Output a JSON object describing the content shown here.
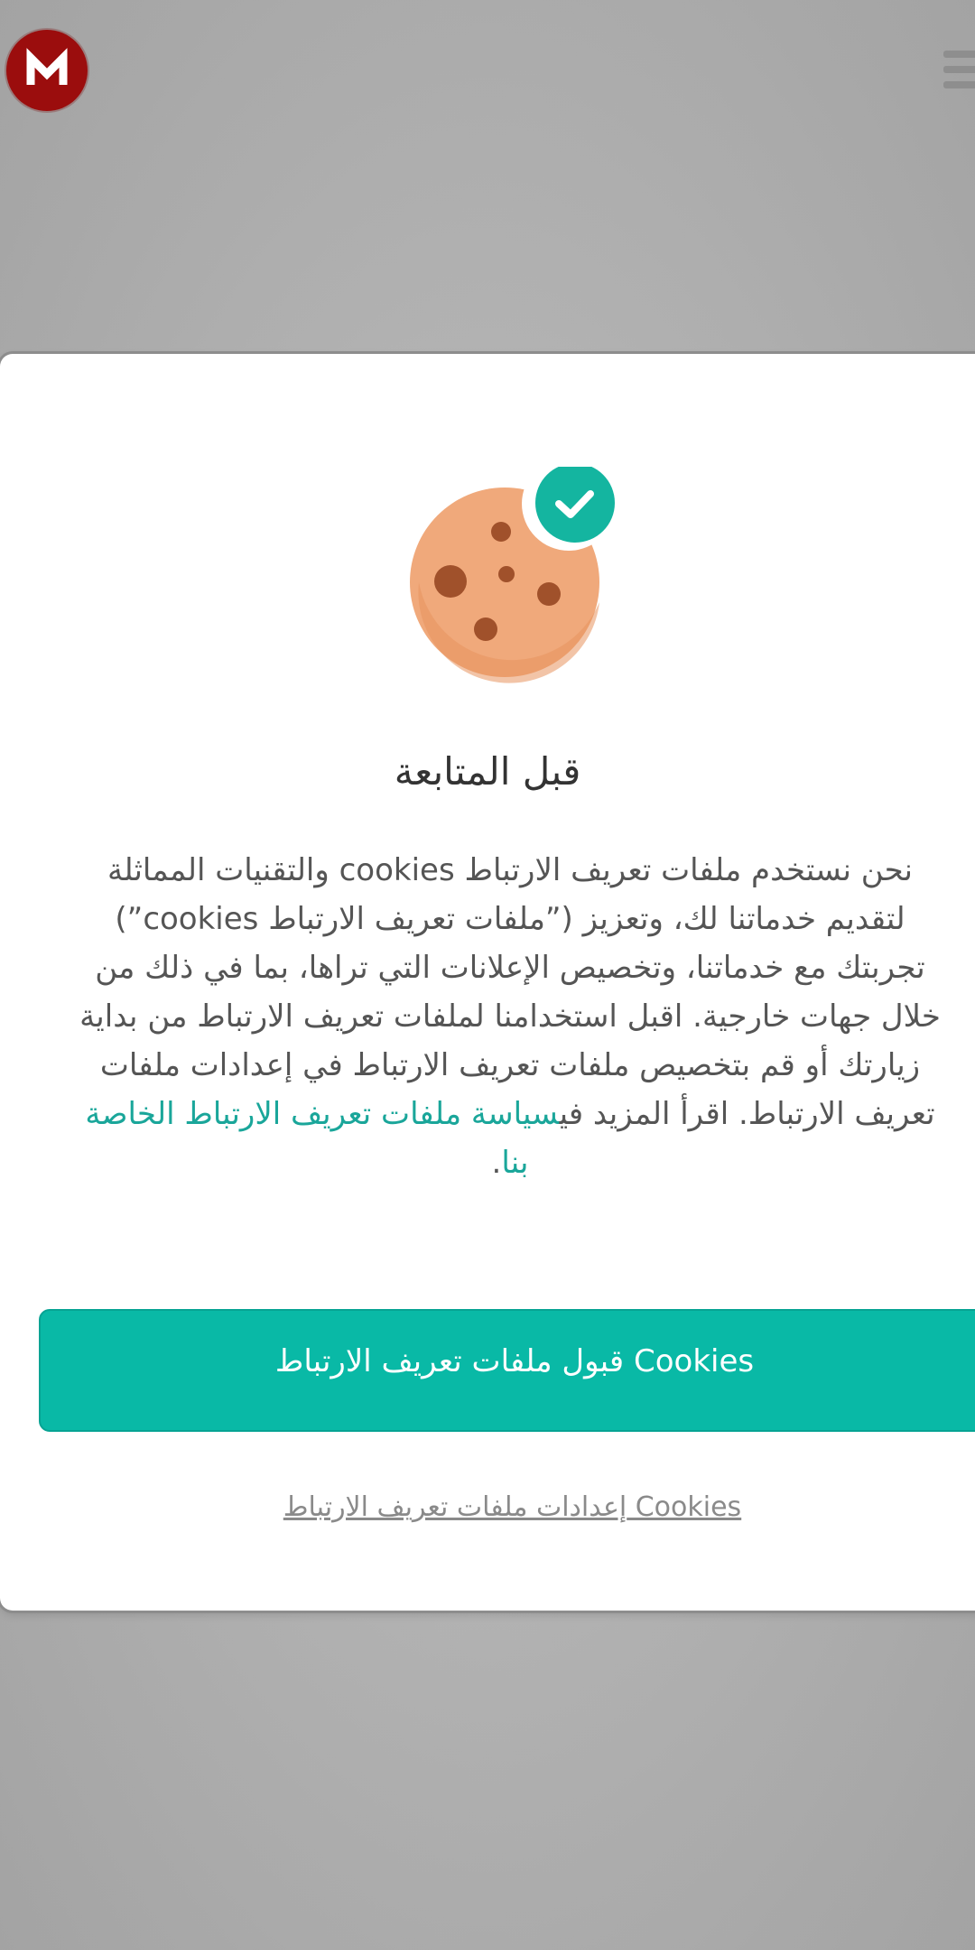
{
  "header": {
    "logo_letter": "M",
    "logo_color": "#9b0d0d",
    "menu_icon": "hamburger-menu-icon"
  },
  "dialog": {
    "illustration": "cookie-with-check-icon",
    "title": "قبل المتابعة",
    "body_text": "نحن نستخدم ملفات تعريف الارتباط cookies والتقنيات المماثلة لتقديم خدماتنا لك، وتعزيز (”ملفات تعريف الارتباط cookies”) تجربتك مع خدماتنا، وتخصيص الإعلانات التي تراها، بما في ذلك من خلال جهات خارجية. اقبل استخدامنا لملفات تعريف الارتباط من بداية زيارتك أو قم بتخصيص ملفات تعريف الارتباط في إعدادات ملفات تعريف الارتباط. اقرأ المزيد في",
    "policy_link": "سياسة ملفات تعريف الارتباط الخاصة بنا",
    "body_end": ".",
    "accept_button": "قبول ملفات تعريف الارتباط Cookies",
    "settings_link": "إعدادات ملفات تعريف الارتباط Cookies"
  },
  "colors": {
    "accent": "#09b9a6",
    "link": "#1aa69a",
    "cookie": "#f0a97b",
    "check_badge": "#14b5a0"
  }
}
